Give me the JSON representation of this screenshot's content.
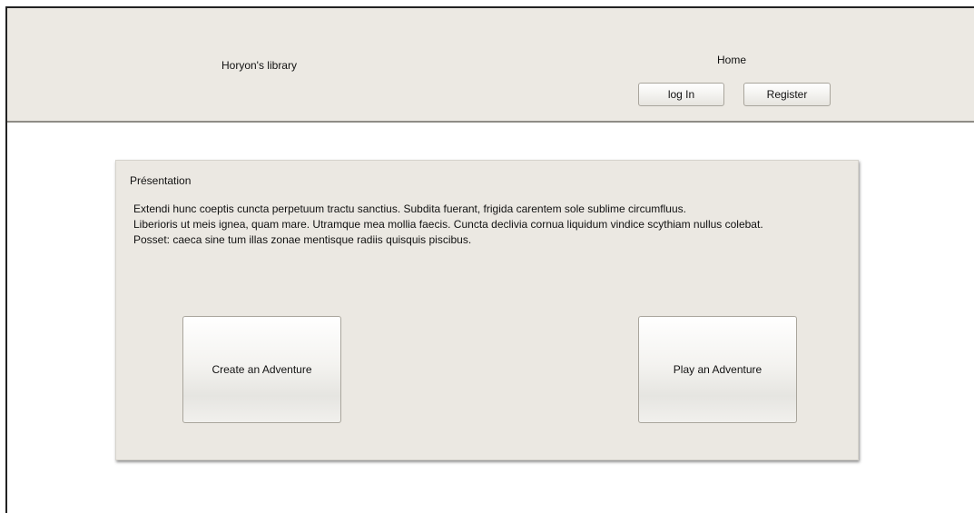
{
  "header": {
    "site_title": "Horyon's library",
    "nav_home": "Home",
    "login_label": "log In",
    "register_label": "Register"
  },
  "presentation": {
    "title": "Présentation",
    "lines": [
      "Extendi hunc coeptis cuncta perpetuum tractu sanctius. Subdita fuerant, frigida carentem sole sublime circumfluus.",
      "Liberioris ut meis ignea, quam mare. Utramque mea mollia faecis. Cuncta declivia cornua liquidum vindice scythiam nullus colebat.",
      "Posset: caeca sine tum illas zonae mentisque radiis quisquis piscibus."
    ],
    "create_label": "Create an Adventure",
    "play_label": "Play an Adventure"
  }
}
